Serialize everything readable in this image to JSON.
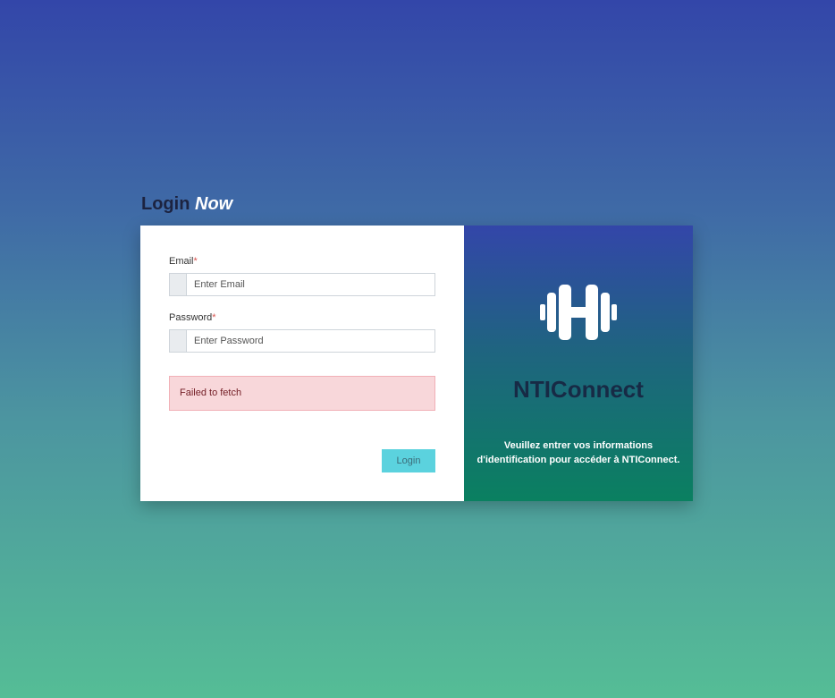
{
  "header": {
    "title_main": "Login",
    "title_accent": "Now"
  },
  "form": {
    "email_label": "Email",
    "email_required": "*",
    "email_placeholder": "Enter Email",
    "password_label": "Password",
    "password_required": "*",
    "password_placeholder": "Enter Password",
    "error_message": "Failed to fetch",
    "login_label": "Login"
  },
  "info": {
    "logo_icon": "dumbbell-icon",
    "brand": "NTIConnect",
    "description": "Veuillez entrer vos informations d'identification pour accéder à NTIConnect."
  },
  "colors": {
    "background_top": "#3346a9",
    "background_bottom": "#55bd96",
    "login_button": "#5bd2de",
    "error_background": "#f8d7da",
    "error_text": "#721c24",
    "brand_text": "#172a45"
  }
}
